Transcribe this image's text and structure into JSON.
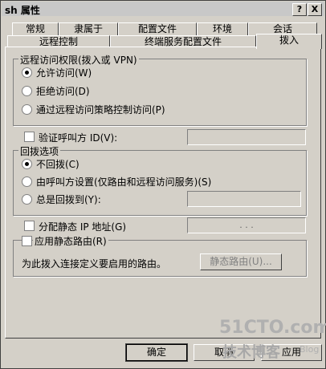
{
  "window": {
    "title": "sh 属性",
    "help_btn": "?",
    "close_btn": "X"
  },
  "tabs_row1": [
    "常规",
    "隶属于",
    "配置文件",
    "环境",
    "会话"
  ],
  "tabs_row2": [
    "远程控制",
    "终端服务配置文件",
    "拨入"
  ],
  "remote_access": {
    "legend": "远程访问权限(拨入或 VPN)",
    "allow": "允许访问(W)",
    "deny": "拒绝访问(D)",
    "policy": "通过远程访问策略控制访问(P)",
    "selected": "allow"
  },
  "verify_caller": {
    "label": "验证呼叫方 ID(V):",
    "value": ""
  },
  "callback": {
    "legend": "回拨选项",
    "none": "不回拨(C)",
    "set_by_caller": "由呼叫方设置(仅路由和远程访问服务)(S)",
    "always": "总是回拨到(Y):",
    "always_value": "",
    "selected": "none"
  },
  "static_ip": {
    "label": "分配静态 IP 地址(G)",
    "ip_value": ". . ."
  },
  "static_routes": {
    "label": "应用静态路由(R)",
    "description": "为此拨入连接定义要启用的路由。",
    "button": "静态路由(U)..."
  },
  "footer": {
    "ok": "确定",
    "cancel": "取消",
    "apply": "应用"
  },
  "watermark": {
    "line1": "51CTO.com",
    "line2": "技术博客",
    "line3": "Blog"
  }
}
